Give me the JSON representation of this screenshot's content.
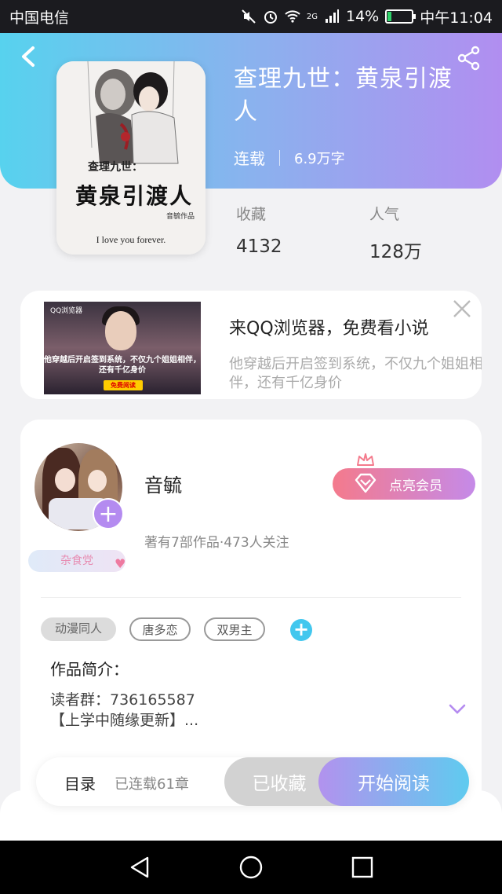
{
  "status_bar": {
    "carrier": "中国电信",
    "network": "2G",
    "battery": "14%",
    "battery_level": 0.14,
    "time": "中午11:04"
  },
  "header": {
    "back_icon": "back-arrow-icon",
    "share_icon": "share-icon",
    "colors": {
      "gradient_start": "#57d2ee",
      "gradient_end": "#b18ef0"
    }
  },
  "book": {
    "title": "查理九世：黄泉引渡人",
    "status": "连载",
    "word_count": "6.9万字",
    "cover": {
      "small_text": "查理九世：",
      "main_text": "黄泉引渡人",
      "author_text": "音毓作品",
      "english_text": "I love you forever."
    },
    "stats": {
      "favorites_label": "收藏",
      "favorites_value": "4132",
      "popularity_label": "人气",
      "popularity_value": "128万"
    }
  },
  "ad": {
    "title": "来QQ浏览器，免费看小说",
    "description": "他穿越后开启签到系统，不仅九个姐姐相伴，还有千亿身价",
    "thumb": {
      "brand": "QQ浏览器",
      "text": "他穿越后开启签到系统，不仅九个姐姐相伴，还有千亿身价",
      "button": "免费阅读"
    },
    "close_icon": "close-icon"
  },
  "author": {
    "name": "音毓",
    "stats": "著有7部作品·473人关注",
    "badge": "杂食党",
    "vip_button": "点亮会员"
  },
  "tags": [
    "动漫同人",
    "唐多恋",
    "双男主"
  ],
  "intro": {
    "heading": "作品简介：",
    "line1": "读者群：736165587",
    "line2": "【上学中随缘更新】..."
  },
  "bottom_bar": {
    "toc_label": "目录",
    "toc_count": "已连载61章",
    "collected_label": "已收藏",
    "read_label": "开始阅读"
  }
}
